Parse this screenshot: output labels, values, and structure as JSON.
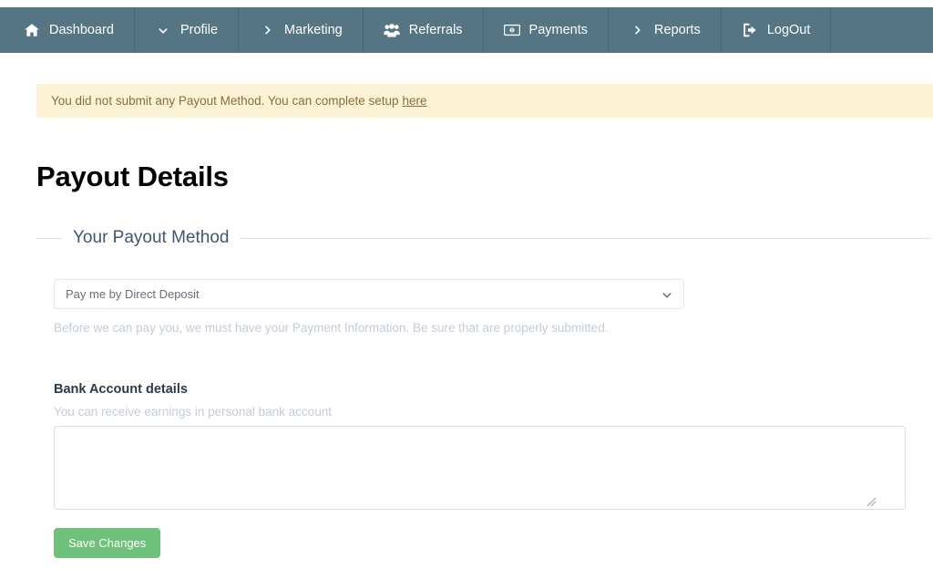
{
  "navbar": {
    "background_color": "#557484",
    "items": [
      {
        "label": "Dashboard",
        "icon": "home-icon"
      },
      {
        "label": "Profile",
        "icon": "chevron-down-icon"
      },
      {
        "label": "Marketing",
        "icon": "chevron-right-icon"
      },
      {
        "label": "Referrals",
        "icon": "users-group-icon"
      },
      {
        "label": "Payments",
        "icon": "money-bill-icon"
      },
      {
        "label": "Reports",
        "icon": "chevron-right-icon"
      },
      {
        "label": "LogOut",
        "icon": "sign-out-icon"
      }
    ]
  },
  "alert": {
    "message": "You did not submit any Payout Method. You can complete setup",
    "link_label": "here",
    "background_color": "#fcf3d7",
    "text_color": "#8a6d3b"
  },
  "page": {
    "title": "Payout Details"
  },
  "fieldset": {
    "legend": "Your Payout Method"
  },
  "payout_method": {
    "selected_option": "Pay me by Direct Deposit",
    "options": [
      "Pay me by Direct Deposit"
    ],
    "chevron_icon": "chevron-down-icon",
    "helper_text": "Before we can pay you, we must have your Payment Information. Be sure that are properly submitted."
  },
  "bank_account": {
    "title": "Bank Account details",
    "subtitle": "You can receive earnings in personal bank account",
    "details_value": "",
    "details_placeholder": "",
    "resize_icon": "resize-grip-icon"
  },
  "actions": {
    "save_label": "Save Changes",
    "save_color": "#6fc07a"
  }
}
